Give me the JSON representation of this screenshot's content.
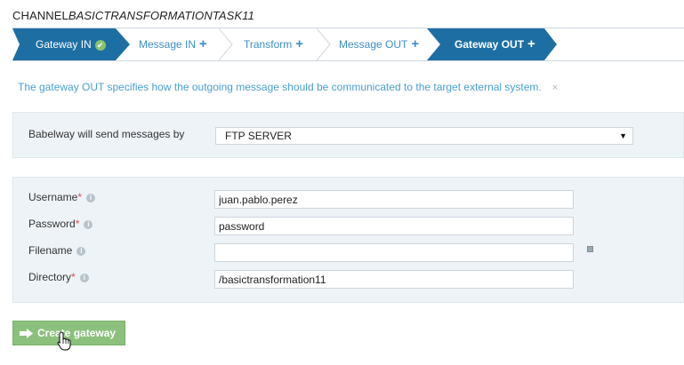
{
  "header": {
    "title_prefix": "CHANNEL",
    "title_name": "BASICTRANSFORMATIONTASK11"
  },
  "wizard": {
    "steps": [
      {
        "label": "Gateway IN",
        "state": "done",
        "icon": "check-icon"
      },
      {
        "label": "Message IN",
        "state": "pending",
        "icon": "plus-icon"
      },
      {
        "label": "Transform",
        "state": "pending",
        "icon": "plus-icon"
      },
      {
        "label": "Message OUT",
        "state": "pending",
        "icon": "plus-icon"
      },
      {
        "label": "Gateway OUT",
        "state": "active",
        "icon": "plus-icon"
      }
    ],
    "plus_symbol": "+",
    "check_symbol": "✔"
  },
  "info": {
    "message": "The gateway OUT specifies how the outgoing message should be communicated to the target external system.",
    "close": "×"
  },
  "send": {
    "label": "Babelway will send messages by",
    "selected": "FTP SERVER",
    "caret": "▼"
  },
  "form": {
    "required_mark": "*",
    "info_mark": "i",
    "username": {
      "label": "Username",
      "value": "juan.pablo.perez"
    },
    "password": {
      "label": "Password",
      "value": "password"
    },
    "filename": {
      "label": "Filename",
      "value": ""
    },
    "directory": {
      "label": "Directory",
      "value": "/basictransformation11"
    }
  },
  "actions": {
    "create_label": "Create gateway"
  },
  "colors": {
    "accent": "#1d6fa3",
    "link": "#3c8fc8",
    "panel": "#eef3f7",
    "button": "#8cc07d",
    "required": "#d9534f"
  }
}
